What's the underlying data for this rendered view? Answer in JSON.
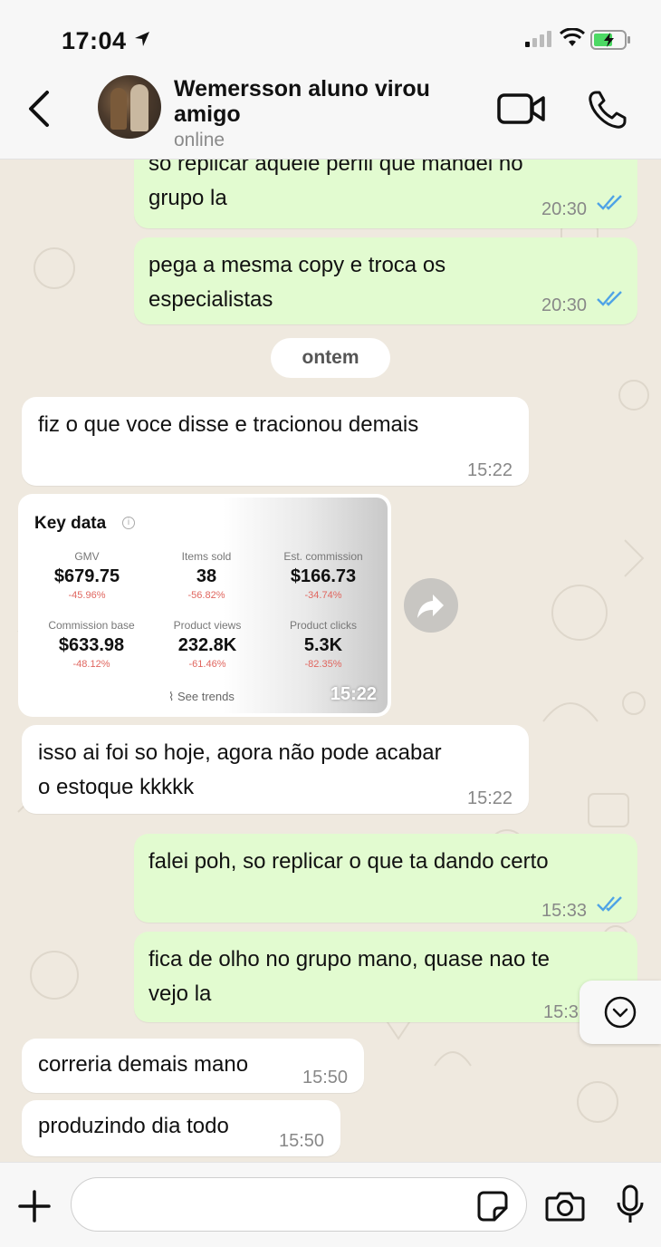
{
  "status_bar": {
    "time": "17:04"
  },
  "header": {
    "contact_name": "Wemersson aluno virou amigo",
    "contact_status": "online"
  },
  "messages": [
    {
      "dir": "out",
      "text_line1": "só replicar aquele perfil que mandei no",
      "text_line2": "grupo la",
      "time": "20:30",
      "read": true
    },
    {
      "dir": "out",
      "text_line1": "pega a mesma copy e troca os",
      "text_line2": "especialistas",
      "time": "20:30",
      "read": true
    },
    {
      "dir": "in",
      "text": "fiz o que voce disse e tracionou demais",
      "time": "15:22"
    },
    {
      "dir": "in",
      "text_line1": "isso ai foi so hoje, agora não pode acabar",
      "text_line2": "o estoque kkkkk",
      "time": "15:22"
    },
    {
      "dir": "out",
      "text": "falei poh, so replicar o que ta dando certo",
      "time": "15:33",
      "read": true
    },
    {
      "dir": "out",
      "text_line1": "fica de olho no grupo mano, quase nao te",
      "text_line2": "vejo la",
      "time": "15:3"
    },
    {
      "dir": "in",
      "text": "correria demais mano",
      "time": "15:50"
    },
    {
      "dir": "in",
      "text": "produzindo dia todo",
      "time": "15:50"
    }
  ],
  "date_separator": "ontem",
  "image_message": {
    "time": "15:22",
    "title": "Key data",
    "info_glyph": "i",
    "metrics": [
      {
        "label": "GMV",
        "value": "$679.75",
        "change": "-45.96%"
      },
      {
        "label": "Items sold",
        "value": "38",
        "change": "-56.82%"
      },
      {
        "label": "Est. commission",
        "value": "$166.73",
        "change": "-34.74%"
      },
      {
        "label": "Commission base",
        "value": "$633.98",
        "change": "-48.12%"
      },
      {
        "label": "Product views",
        "value": "232.8K",
        "change": "-61.46%"
      },
      {
        "label": "Product clicks",
        "value": "5.3K",
        "change": "-82.35%"
      }
    ],
    "see_trends": "See trends"
  },
  "colors": {
    "outgoing_bubble": "#e2fbd0",
    "incoming_bubble": "#ffffff",
    "read_ticks": "#4fa3e6",
    "chat_background": "#efe9df",
    "negative_change": "#e0665f"
  },
  "icons": {
    "back": "chevron-left-icon",
    "video": "video-camera-icon",
    "call": "phone-icon",
    "forward": "forward-icon",
    "scroll_down": "chevron-down-circle-icon",
    "plus": "plus-icon",
    "sticker": "sticker-icon",
    "camera": "camera-icon",
    "mic": "microphone-icon"
  },
  "composer": {
    "placeholder": ""
  }
}
